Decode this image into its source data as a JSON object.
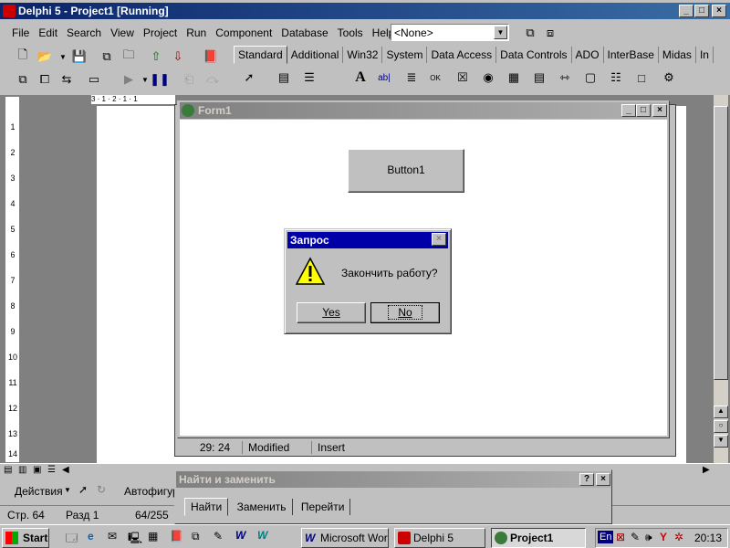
{
  "ide": {
    "title": "Delphi 5 - Project1 [Running]",
    "menu": [
      "File",
      "Edit",
      "Search",
      "View",
      "Project",
      "Run",
      "Component",
      "Database",
      "Tools",
      "Help"
    ],
    "combo_value": "<None>",
    "palette_tabs": [
      "Standard",
      "Additional",
      "Win32",
      "System",
      "Data Access",
      "Data Controls",
      "ADO",
      "InterBase",
      "Midas",
      "In"
    ]
  },
  "form": {
    "title": "Form1",
    "button_label": "Button1"
  },
  "dialog": {
    "title": "Запрос",
    "message": "Закончить работу?",
    "yes_label": "Yes",
    "no_label": "No"
  },
  "editor_status": {
    "position": "29: 24",
    "modified": "Modified",
    "mode": "Insert"
  },
  "find_replace": {
    "title": "Найти и заменить",
    "tabs": [
      "Найти",
      "Заменить",
      "Перейти"
    ]
  },
  "word": {
    "draw_actions": "Действия",
    "autoshapes": "Автофигур",
    "status_page": "Стр. 64",
    "status_section": "Разд 1",
    "status_pages": "64/255"
  },
  "taskbar": {
    "start_label": "Start",
    "tasks": [
      "Microsoft Wor...",
      "Delphi 5",
      "Project1"
    ],
    "lang": "En",
    "clock": "20:13"
  },
  "ruler_left": [
    "1",
    "2",
    "3",
    "4",
    "5",
    "6",
    "7",
    "8",
    "9",
    "10",
    "11",
    "12",
    "13",
    "14"
  ],
  "ruler_top": "3 · 1 · 2 · 1 · 1",
  "colors": {
    "titlebar_active": "#0a246a",
    "titlebar_inactive": "#808080",
    "face": "#c0c0c0",
    "warning": "#ffff00"
  }
}
